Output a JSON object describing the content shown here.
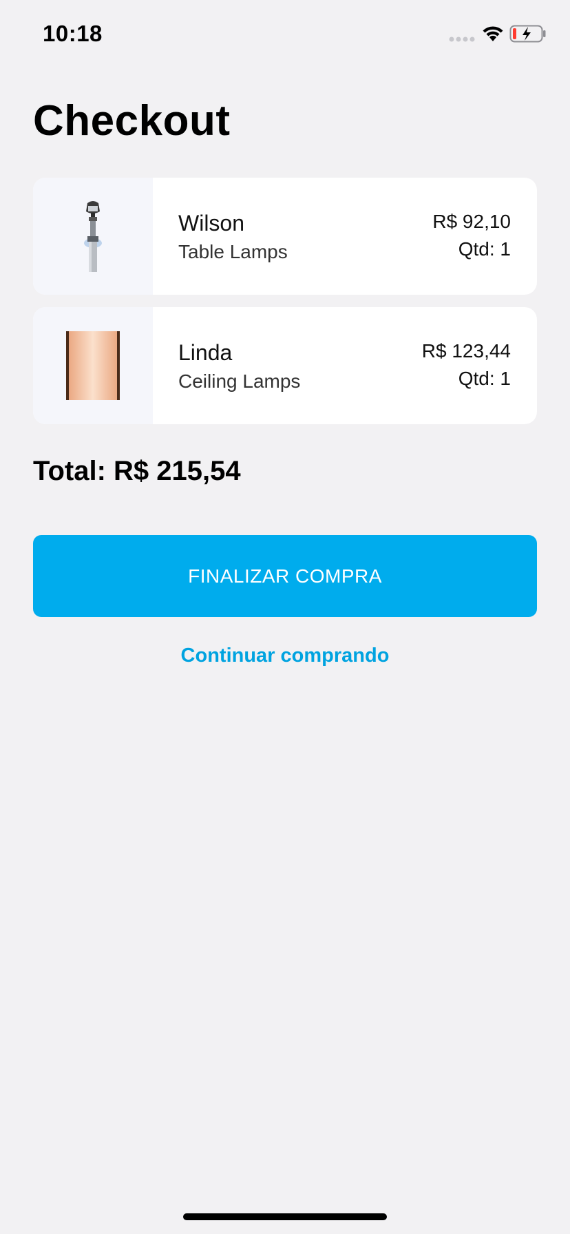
{
  "status_bar": {
    "time": "10:18",
    "icons": [
      "signal-icon",
      "wifi-icon",
      "battery-charging-icon"
    ]
  },
  "page": {
    "title": "Checkout"
  },
  "cart": {
    "items": [
      {
        "name": "Wilson",
        "category": "Table Lamps",
        "price": "R$ 92,10",
        "quantity": "Qtd: 1",
        "image": "street-lamp-image"
      },
      {
        "name": "Linda",
        "category": "Ceiling Lamps",
        "price": "R$ 123,44",
        "quantity": "Qtd: 1",
        "image": "panel-lamp-image"
      }
    ],
    "total": "Total: R$ 215,54"
  },
  "actions": {
    "checkout_label": "FINALIZAR COMPRA",
    "continue_label": "Continuar comprando"
  },
  "colors": {
    "background": "#f2f1f3",
    "accent": "#00aced",
    "card": "#ffffff",
    "thumb_background": "#f5f6fb"
  }
}
